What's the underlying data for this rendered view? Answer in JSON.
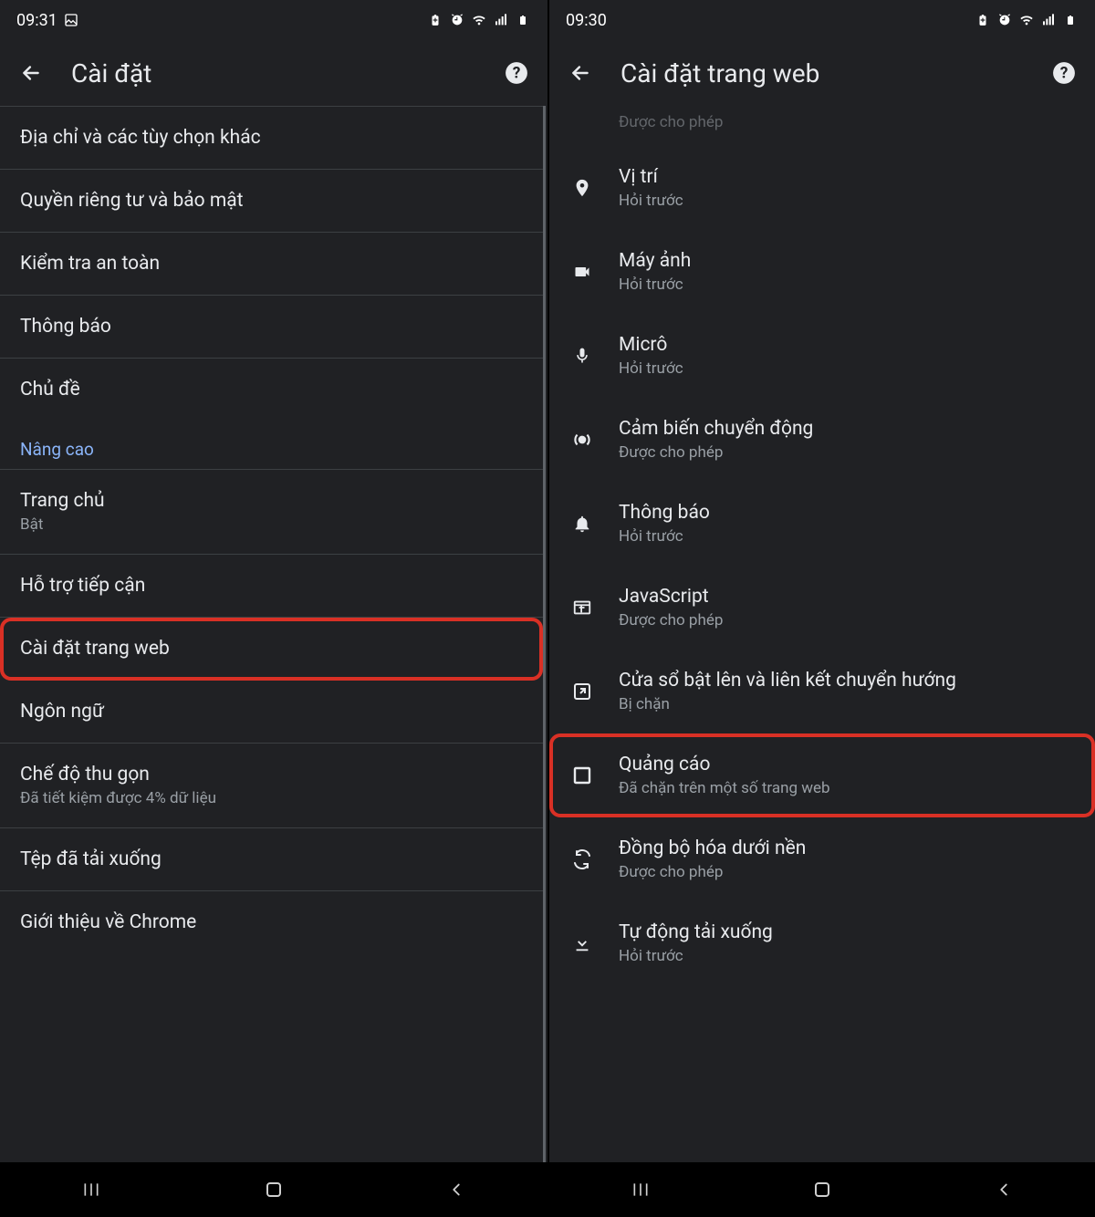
{
  "screen1": {
    "status": {
      "time": "09:31"
    },
    "title": "Cài đặt",
    "items": [
      {
        "primary": "Địa chỉ và các tùy chọn khác"
      },
      {
        "primary": "Quyền riêng tư và bảo mật"
      },
      {
        "primary": "Kiểm tra an toàn"
      },
      {
        "primary": "Thông báo"
      },
      {
        "primary": "Chủ đề"
      }
    ],
    "section_label": "Nâng cao",
    "items2": [
      {
        "primary": "Trang chủ",
        "secondary": "Bật"
      },
      {
        "primary": "Hỗ trợ tiếp cận"
      },
      {
        "primary": "Cài đặt trang web",
        "highlight": true
      },
      {
        "primary": "Ngôn ngữ"
      },
      {
        "primary": "Chế độ thu gọn",
        "secondary": "Đã tiết kiệm được 4% dữ liệu"
      },
      {
        "primary": "Tệp đã tải xuống"
      },
      {
        "primary": "Giới thiệu về Chrome"
      }
    ]
  },
  "screen2": {
    "status": {
      "time": "09:30"
    },
    "title": "Cài đặt trang web",
    "truncated": {
      "secondary": "Được cho phép"
    },
    "items": [
      {
        "icon": "location",
        "primary": "Vị trí",
        "secondary": "Hỏi trước"
      },
      {
        "icon": "camera",
        "primary": "Máy ảnh",
        "secondary": "Hỏi trước"
      },
      {
        "icon": "mic",
        "primary": "Micrô",
        "secondary": "Hỏi trước"
      },
      {
        "icon": "motion",
        "primary": "Cảm biến chuyển động",
        "secondary": "Được cho phép"
      },
      {
        "icon": "bell",
        "primary": "Thông báo",
        "secondary": "Hỏi trước"
      },
      {
        "icon": "js",
        "primary": "JavaScript",
        "secondary": "Được cho phép"
      },
      {
        "icon": "popup",
        "primary": "Cửa sổ bật lên và liên kết chuyển hướng",
        "secondary": "Bị chặn"
      },
      {
        "icon": "ads",
        "primary": "Quảng cáo",
        "secondary": "Đã chặn trên một số trang web",
        "highlight": true
      },
      {
        "icon": "sync",
        "primary": "Đồng bộ hóa dưới nền",
        "secondary": "Được cho phép"
      },
      {
        "icon": "download",
        "primary": "Tự động tải xuống",
        "secondary": "Hỏi trước"
      }
    ]
  }
}
